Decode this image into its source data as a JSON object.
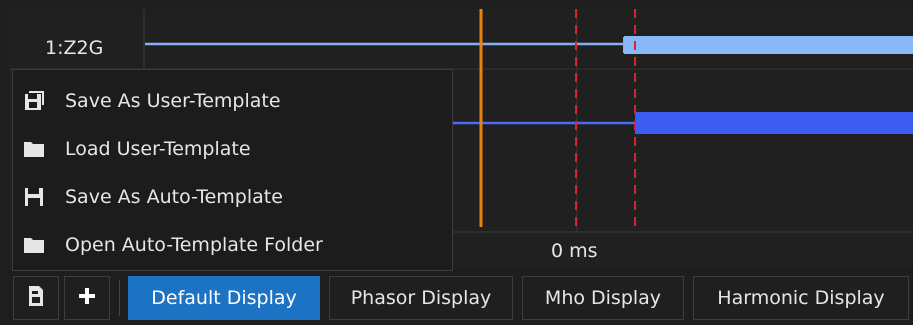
{
  "plot": {
    "channel_label": "1:Z2G",
    "time_label": "0 ms"
  },
  "context_menu": {
    "items": [
      {
        "label": "Save As User-Template",
        "icon": "save-as-icon"
      },
      {
        "label": "Load User-Template",
        "icon": "folder-icon"
      },
      {
        "label": "Save As Auto-Template",
        "icon": "save-icon"
      },
      {
        "label": "Open Auto-Template Folder",
        "icon": "folder-icon"
      }
    ]
  },
  "toolbar": {
    "tabs": [
      {
        "label": "Default Display",
        "active": true
      },
      {
        "label": "Phasor Display",
        "active": false
      },
      {
        "label": "Mho Display",
        "active": false
      },
      {
        "label": "Harmonic Display",
        "active": false
      }
    ],
    "add_icon": "plus-icon",
    "doc_icon": "document-icon"
  },
  "colors": {
    "active_tab": "#1c73c4",
    "cursor_orange": "#e8830f",
    "marker_red": "#e0202a",
    "trace_light_blue": "#7fb2f5",
    "trace_blue": "#3d5cf0"
  }
}
